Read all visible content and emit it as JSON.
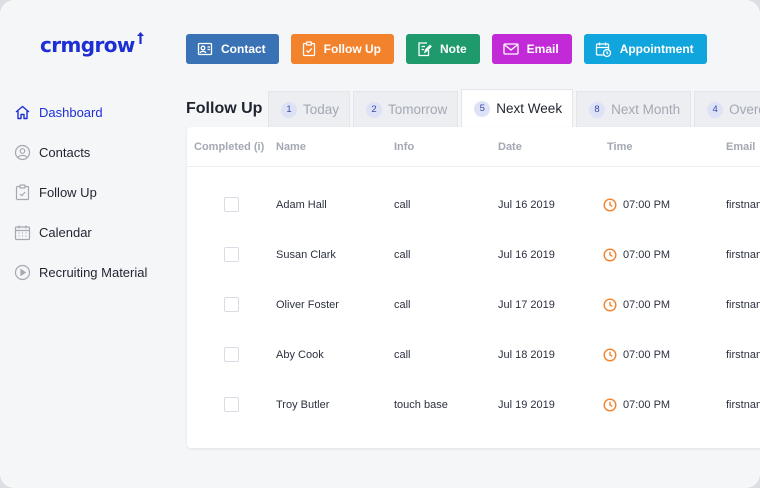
{
  "brand": {
    "logo_text": "crmgrow",
    "accent": "#1d2fd4"
  },
  "toolbar": [
    {
      "label": "Contact",
      "icon": "contact-card-icon",
      "color": "#3a73b5"
    },
    {
      "label": "Follow Up",
      "icon": "clipboard-icon",
      "color": "#f2822c"
    },
    {
      "label": "Note",
      "icon": "note-edit-icon",
      "color": "#1e9a6d"
    },
    {
      "label": "Email",
      "icon": "envelope-icon",
      "color": "#c12ad6"
    },
    {
      "label": "Appointment",
      "icon": "calendar-clock-icon",
      "color": "#10a5dc"
    }
  ],
  "sidebar": {
    "items": [
      {
        "label": "Dashboard",
        "icon": "home-icon",
        "active": true
      },
      {
        "label": "Contacts",
        "icon": "user-circle-icon",
        "active": false
      },
      {
        "label": "Follow Up",
        "icon": "clipboard-icon",
        "active": false
      },
      {
        "label": "Calendar",
        "icon": "calendar-icon",
        "active": false
      },
      {
        "label": "Recruiting Material",
        "icon": "play-circle-icon",
        "active": false
      }
    ]
  },
  "followup": {
    "title": "Follow Up",
    "tabs": [
      {
        "count": "1",
        "label": "Today",
        "active": false
      },
      {
        "count": "2",
        "label": "Tomorrow",
        "active": false
      },
      {
        "count": "5",
        "label": "Next Week",
        "active": true
      },
      {
        "count": "8",
        "label": "Next Month",
        "active": false
      },
      {
        "count": "4",
        "label": "Overdue",
        "active": false
      }
    ],
    "columns": [
      "Completed (i)",
      "Name",
      "Info",
      "Date",
      "Time",
      "Email"
    ],
    "rows": [
      {
        "name": "Adam Hall",
        "info": "call",
        "date": "Jul 16 2019",
        "time": "07:00 PM",
        "email": "firstnam"
      },
      {
        "name": "Susan Clark",
        "info": "call",
        "date": "Jul 16 2019",
        "time": "07:00 PM",
        "email": "firstnam"
      },
      {
        "name": "Oliver Foster",
        "info": "call",
        "date": "Jul 17 2019",
        "time": "07:00 PM",
        "email": "firstnam"
      },
      {
        "name": "Aby Cook",
        "info": "call",
        "date": "Jul 18 2019",
        "time": "07:00 PM",
        "email": "firstnam"
      },
      {
        "name": "Troy Butler",
        "info": "touch base",
        "date": "Jul 19 2019",
        "time": "07:00 PM",
        "email": "firstnam"
      }
    ]
  }
}
